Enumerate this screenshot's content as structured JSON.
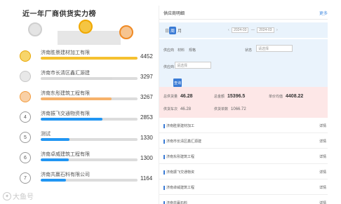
{
  "left": {
    "title": "近一年厂商供货实力榜",
    "podium_colors": {
      "gold": "#f5c542",
      "silver": "#d9d9d9",
      "bronze": "#f08a24"
    },
    "ranks": [
      {
        "rank": "",
        "tier": "gold",
        "name": "济南胜景建材加工有限",
        "value": "4452",
        "fill": 1.0,
        "color": "#f5c130"
      },
      {
        "rank": "",
        "tier": "silver",
        "name": "济南市长清区鑫汇源建",
        "value": "3297",
        "fill": 0.74,
        "color": "#d9d9d9"
      },
      {
        "rank": "",
        "tier": "bronze",
        "name": "济南东彤建筑工程有限",
        "value": "3267",
        "fill": 0.73,
        "color": "#f6b26b"
      },
      {
        "rank": "4",
        "tier": "",
        "name": "济南振飞交通物资有限",
        "value": "2853",
        "fill": 0.64,
        "color": "#2196f3"
      },
      {
        "rank": "5",
        "tier": "",
        "name": "测试",
        "value": "1330",
        "fill": 0.3,
        "color": "#2196f3"
      },
      {
        "rank": "6",
        "tier": "",
        "name": "济南卓威建筑工程有限",
        "value": "1300",
        "fill": 0.29,
        "color": "#2196f3"
      },
      {
        "rank": "7",
        "tier": "",
        "name": "济南共赢石料有限公司",
        "value": "1164",
        "fill": 0.26,
        "color": "#2196f3"
      }
    ]
  },
  "right": {
    "header_title": "供应商明细",
    "header_link": "更多",
    "tabs": [
      "日",
      "周",
      "月"
    ],
    "pager_prev": "2024-03",
    "pager_next": "2024-03",
    "filter": {
      "label_1": "供应商",
      "label_2": "材料",
      "label_3": "规格",
      "label_4": "状态",
      "input_1": "",
      "input_2": "请选择",
      "input_3": "请选择",
      "button": "查询"
    },
    "stats": [
      {
        "label": "总供货量",
        "value": "46.28"
      },
      {
        "label": "总金额",
        "value": "15396.5"
      },
      {
        "label": "单价均值",
        "value": "4408.22"
      },
      {
        "label": "供货车次",
        "value": "46.28"
      },
      {
        "label": "供货单数",
        "value": "1066.72"
      }
    ],
    "list": [
      {
        "text": "济南胜景建材加工",
        "side": "详情"
      },
      {
        "text": "济南市长清区鑫汇源建",
        "side": "详情"
      },
      {
        "text": "济南东彤建筑工程",
        "side": "详情"
      },
      {
        "text": "济南振飞交通物资",
        "side": "详情"
      },
      {
        "text": "济南卓威建筑工程",
        "side": "详情"
      },
      {
        "text": "济南共赢石料",
        "side": "详情"
      }
    ]
  },
  "watermark": "大鱼号"
}
